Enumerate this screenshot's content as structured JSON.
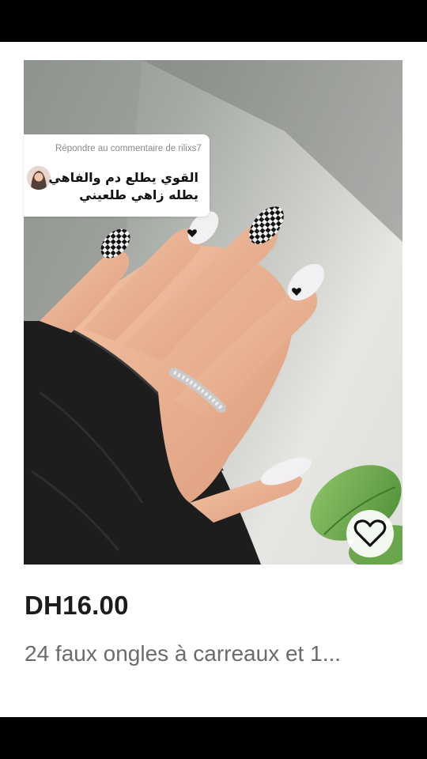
{
  "comment": {
    "reply_heading": "Répondre au commentaire de rilixs7",
    "text": "القوي يطلع دم والفاهي يطله زاهي طلعيني"
  },
  "product": {
    "price": "DH16.00",
    "title": "24 faux ongles à carreaux et 1...",
    "wishlist_icon": "heart-outline-icon"
  },
  "colors": {
    "price_text": "#1c1c1c",
    "title_text": "#6b6b6b",
    "status_bar": "#000000"
  }
}
